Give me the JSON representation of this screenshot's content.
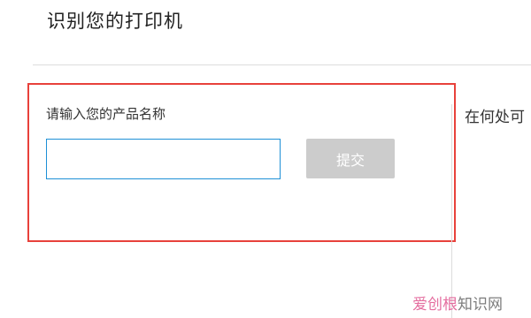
{
  "page": {
    "title": "识别您的打印机"
  },
  "form": {
    "label": "请输入您的产品名称",
    "input_value": "",
    "submit_label": "提交"
  },
  "side_panel": {
    "heading": "在何处可"
  },
  "watermark": {
    "text_pink": "爱创根",
    "text_gray": "知识网"
  },
  "colors": {
    "highlight_border": "#e8413b",
    "input_border": "#1e90d6",
    "button_disabled": "#cccccc",
    "watermark_pink": "#e0558f",
    "watermark_gray": "#666666"
  }
}
